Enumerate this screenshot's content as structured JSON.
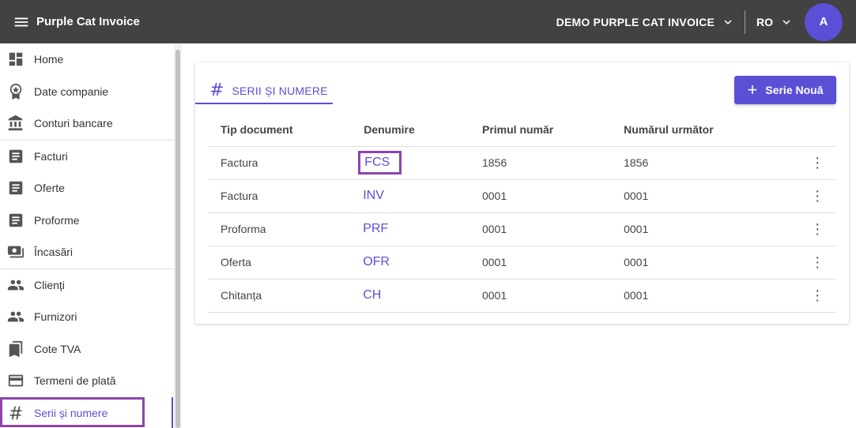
{
  "app": {
    "title": "Purple Cat Invoice"
  },
  "header": {
    "company": "DEMO PURPLE CAT INVOICE",
    "language": "RO",
    "avatar_initial": "A"
  },
  "sidebar": {
    "items": [
      {
        "label": "Home",
        "icon": "dashboard-icon"
      },
      {
        "label": "Date companie",
        "icon": "badge-icon"
      },
      {
        "label": "Conturi bancare",
        "icon": "bank-icon"
      },
      {
        "label": "Facturi",
        "icon": "document-icon"
      },
      {
        "label": "Oferte",
        "icon": "document-icon"
      },
      {
        "label": "Proforme",
        "icon": "document-icon"
      },
      {
        "label": "Încasări",
        "icon": "cash-icon"
      },
      {
        "label": "Clienți",
        "icon": "people-icon"
      },
      {
        "label": "Furnizori",
        "icon": "people-icon"
      },
      {
        "label": "Cote TVA",
        "icon": "bookmarks-icon"
      },
      {
        "label": "Termeni de plată",
        "icon": "credit-card-icon"
      },
      {
        "label": "Serii și numere",
        "icon": "hash-icon"
      }
    ]
  },
  "main": {
    "tab_label": "SERII ȘI NUMERE",
    "new_button_label": "Serie Nouă",
    "table": {
      "headers": [
        "Tip document",
        "Denumire",
        "Primul număr",
        "Numărul următor"
      ],
      "rows": [
        {
          "type": "Factura",
          "name": "FCS",
          "first": "1856",
          "next": "1856"
        },
        {
          "type": "Factura",
          "name": "INV",
          "first": "0001",
          "next": "0001"
        },
        {
          "type": "Proforma",
          "name": "PRF",
          "first": "0001",
          "next": "0001"
        },
        {
          "type": "Oferta",
          "name": "OFR",
          "first": "0001",
          "next": "0001"
        },
        {
          "type": "Chitanța",
          "name": "CH",
          "first": "0001",
          "next": "0001"
        }
      ]
    }
  },
  "colors": {
    "accent": "#5b4fd6",
    "topbar": "#424242",
    "highlight": "#8e44ad"
  }
}
